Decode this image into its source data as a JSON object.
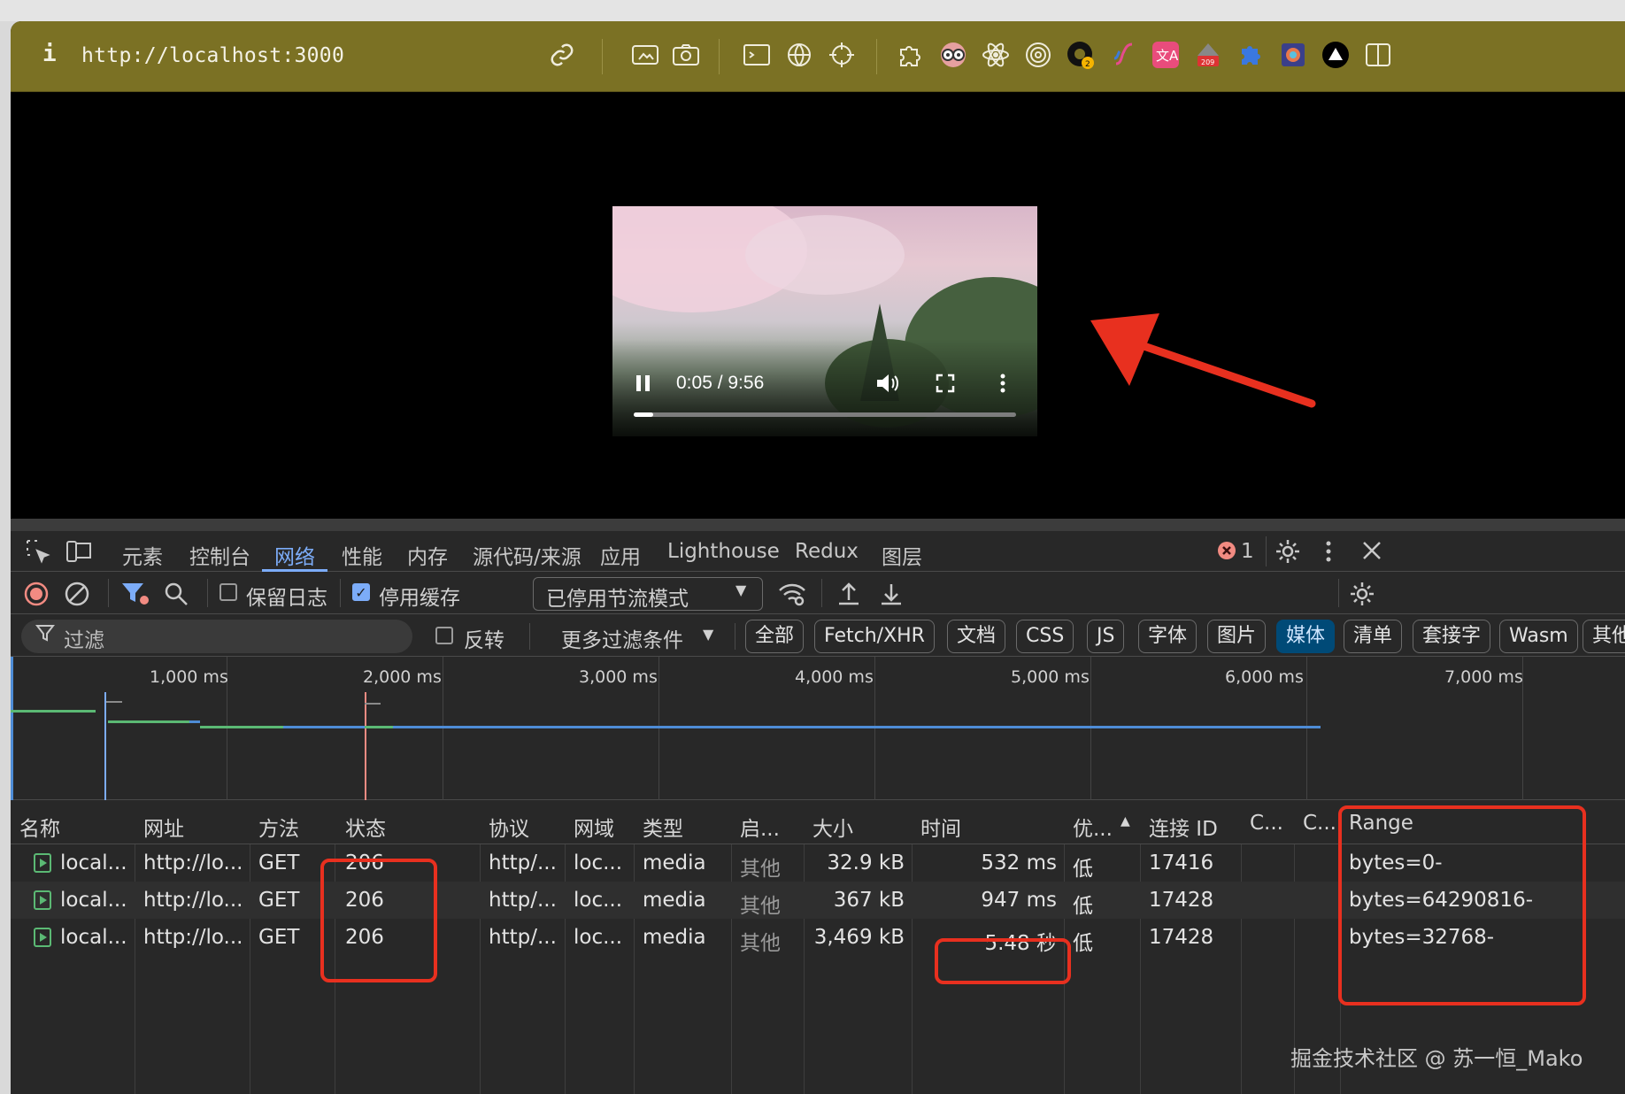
{
  "address_bar": {
    "info_icon": "i",
    "url": "http://localhost:3000",
    "icons": [
      "link-icon",
      "screenshot-icon",
      "camera-icon",
      "terminal-icon",
      "globe-icon",
      "crosshair-icon",
      "puzzle-icon",
      "eyes-icon",
      "react-icon",
      "target-icon",
      "extension-badge-icon",
      "script-icon",
      "translate-icon",
      "extension-icon",
      "puzzle-blue-icon",
      "color-picker-icon",
      "vercel-icon",
      "sidebar-icon"
    ]
  },
  "video": {
    "time": "0:05 / 9:56",
    "progress": 0.05
  },
  "devtools": {
    "tabs": [
      "元素",
      "控制台",
      "网络",
      "性能",
      "内存",
      "源代码/来源",
      "应用",
      "Lighthouse",
      "Redux",
      "图层"
    ],
    "active_tab": "网络",
    "error_count": "1",
    "toolbar": {
      "preserve_log": "保留日志",
      "disable_cache": "停用缓存",
      "throttle": "已停用节流模式"
    },
    "filter": {
      "placeholder": "过滤",
      "invert": "反转",
      "more_filters": "更多过滤条件",
      "chips": [
        "全部",
        "Fetch/XHR",
        "文档",
        "CSS",
        "JS",
        "字体",
        "图片",
        "媒体",
        "清单",
        "套接字",
        "Wasm",
        "其他"
      ],
      "active_chip": "媒体"
    },
    "timeline_labels": [
      "1,000 ms",
      "2,000 ms",
      "3,000 ms",
      "4,000 ms",
      "5,000 ms",
      "6,000 ms",
      "7,000 ms"
    ],
    "columns": [
      "名称",
      "网址",
      "方法",
      "状态",
      "协议",
      "网域",
      "类型",
      "启...",
      "大小",
      "时间",
      "优...",
      "连接 ID",
      "C...",
      "C...",
      "Range"
    ],
    "rows": [
      {
        "name": "local...",
        "url": "http://lo...",
        "method": "GET",
        "status": "206",
        "protocol": "http/...",
        "domain": "loc...",
        "type": "media",
        "initiator": "其他",
        "size": "32.9 kB",
        "time": "532 ms",
        "priority": "低",
        "conn": "17416",
        "range": "bytes=0-"
      },
      {
        "name": "local...",
        "url": "http://lo...",
        "method": "GET",
        "status": "206",
        "protocol": "http/...",
        "domain": "loc...",
        "type": "media",
        "initiator": "其他",
        "size": "367 kB",
        "time": "947 ms",
        "priority": "低",
        "conn": "17428",
        "range": "bytes=64290816-"
      },
      {
        "name": "local...",
        "url": "http://lo...",
        "method": "GET",
        "status": "206",
        "protocol": "http/...",
        "domain": "loc...",
        "type": "media",
        "initiator": "其他",
        "size": "3,469 kB",
        "time": "5.48 秒",
        "priority": "低",
        "conn": "17428",
        "range": "bytes=32768-"
      }
    ]
  },
  "watermark": "掘金技术社区 @ 苏一恒_Mako",
  "colors": {
    "address_bar": "#7b7124",
    "accent": "#7cacf8",
    "highlight": "#e8301f",
    "media_chip": "#004a77"
  }
}
